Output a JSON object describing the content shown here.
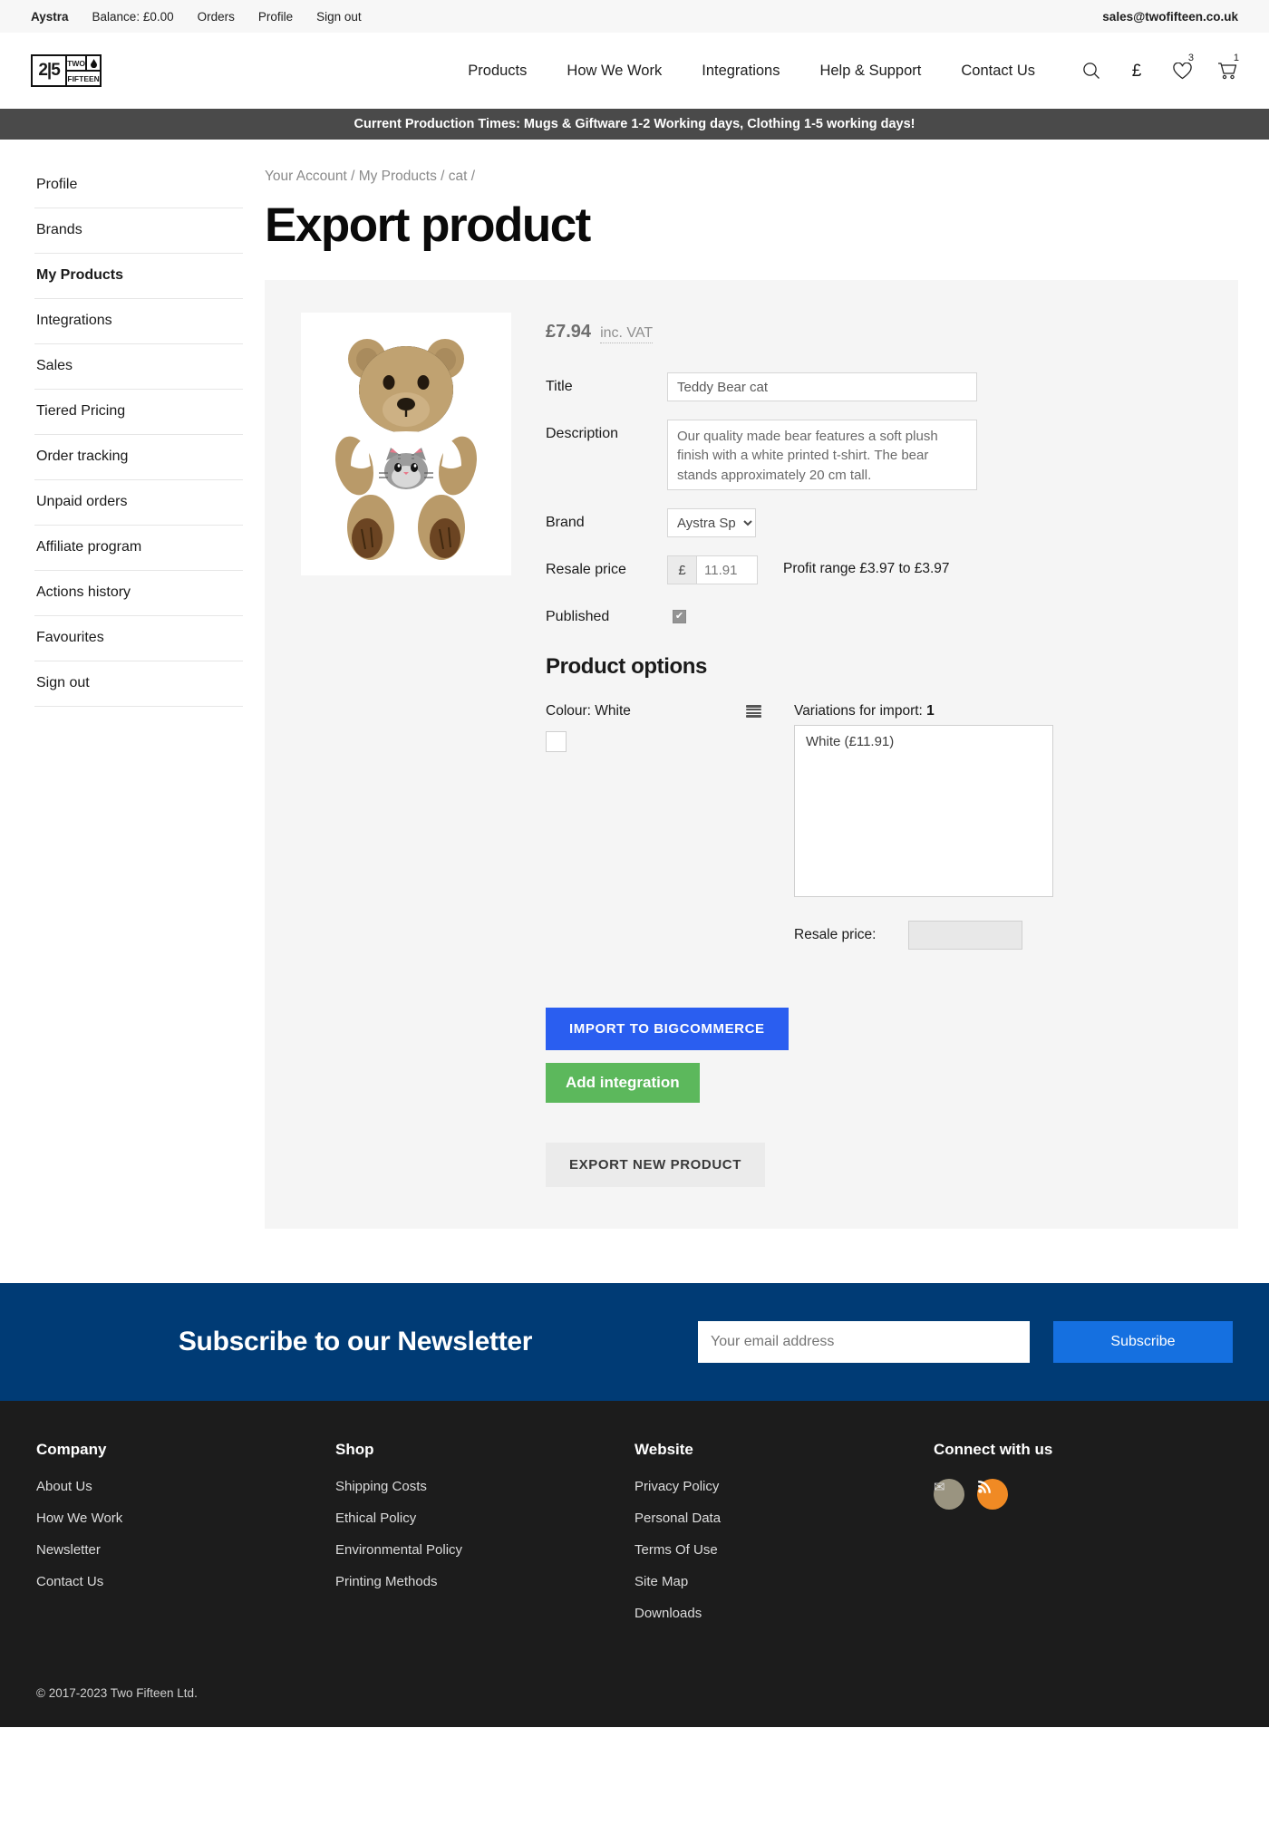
{
  "utility_bar": {
    "account_name": "Aystra",
    "balance": "Balance: £0.00",
    "orders": "Orders",
    "profile": "Profile",
    "sign_out": "Sign out",
    "email": "sales@twofifteen.co.uk"
  },
  "logo": {
    "mark": "2|5",
    "two": "TWO",
    "fifteen": "FIFTEEN",
    "drop": "◊"
  },
  "nav": {
    "items": [
      {
        "label": "Products"
      },
      {
        "label": "How We Work"
      },
      {
        "label": "Integrations"
      },
      {
        "label": "Help & Support"
      },
      {
        "label": "Contact Us"
      }
    ],
    "currency_symbol": "£",
    "wishlist_count": "3",
    "cart_count": "1"
  },
  "announcement": "Current Production Times: Mugs & Giftware 1-2 Working days, Clothing 1-5 working days!",
  "sidebar": {
    "items": [
      {
        "label": "Profile",
        "active": false
      },
      {
        "label": "Brands",
        "active": false
      },
      {
        "label": "My Products",
        "active": true
      },
      {
        "label": "Integrations",
        "active": false
      },
      {
        "label": "Sales",
        "active": false
      },
      {
        "label": "Tiered Pricing",
        "active": false
      },
      {
        "label": "Order tracking",
        "active": false
      },
      {
        "label": "Unpaid orders",
        "active": false
      },
      {
        "label": "Affiliate program",
        "active": false
      },
      {
        "label": "Actions history",
        "active": false
      },
      {
        "label": "Favourites",
        "active": false
      },
      {
        "label": "Sign out",
        "active": false
      }
    ]
  },
  "breadcrumb": "Your Account / My Products / cat /",
  "page_title": "Export product",
  "product": {
    "price_amount": "£7.94",
    "price_vat_note": "inc. VAT",
    "fields": {
      "title_label": "Title",
      "title_value": "Teddy Bear cat",
      "description_label": "Description",
      "description_value": "Our quality made bear features a soft plush finish with a white printed t-shirt. The bear stands approximately 20 cm tall.",
      "brand_label": "Brand",
      "brand_value": "Aystra Sp",
      "brand_options": [
        "Aystra Sp"
      ],
      "resale_price_label": "Resale price",
      "resale_currency": "£",
      "resale_price_value": "11.91",
      "profit_range": "Profit range £3.97 to £3.97",
      "published_label": "Published",
      "published_checked": true,
      "published_check_glyph": "✔"
    }
  },
  "product_options": {
    "heading": "Product options",
    "colour_label": "Colour: White",
    "swatch_color": "#ffffff",
    "variations_label": "Variations for import:",
    "variations_count": "1",
    "variations": [
      "White (£11.91)"
    ],
    "resale_price_label": "Resale price:",
    "resale_price_value": ""
  },
  "actions": {
    "import_label": "IMPORT TO BIGCOMMERCE",
    "import_color": "#2a5ef0",
    "add_integration_label": "Add integration",
    "add_integration_color": "#5cb85c",
    "export_new_label": "EXPORT NEW PRODUCT"
  },
  "newsletter": {
    "title": "Subscribe to our Newsletter",
    "placeholder": "Your email address",
    "value": "",
    "button_label": "Subscribe",
    "background": "#003b75"
  },
  "footer": {
    "columns": [
      {
        "heading": "Company",
        "links": [
          "About Us",
          "How We Work",
          "Newsletter",
          "Contact Us"
        ]
      },
      {
        "heading": "Shop",
        "links": [
          "Shipping Costs",
          "Ethical Policy",
          "Environmental Policy",
          "Printing Methods"
        ]
      },
      {
        "heading": "Website",
        "links": [
          "Privacy Policy",
          "Personal Data",
          "Terms Of Use",
          "Site Map",
          "Downloads"
        ]
      }
    ],
    "connect_heading": "Connect with us",
    "social": [
      {
        "name": "email",
        "glyph": "✉",
        "color": "#9a9480"
      },
      {
        "name": "rss",
        "glyph": "◉",
        "color": "#f08a24"
      }
    ],
    "copyright": "© 2017-2023  Two Fifteen Ltd."
  }
}
